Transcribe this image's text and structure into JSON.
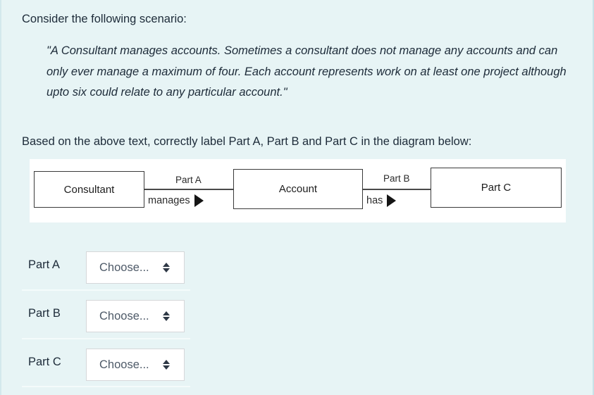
{
  "page": {
    "background_color": "#e7f4f5",
    "text_color": "#1d2b39"
  },
  "question": {
    "intro": "Consider the following scenario:",
    "scenario_quote": "\"A Consultant manages accounts.  Sometimes a consultant does not manage any accounts and can only ever manage a maximum of four.  Each account represents work on at least one project although upto six could relate to any particular account.\"",
    "instruction": "Based on the above text, correctly label Part A, Part B and Part C in the diagram below:"
  },
  "diagram": {
    "entities": [
      {
        "id": "consultant",
        "label": "Consultant"
      },
      {
        "id": "account",
        "label": "Account"
      },
      {
        "id": "partc",
        "label": "Part C"
      }
    ],
    "relationships": [
      {
        "id": "rel-a",
        "cardinality_label": "Part A",
        "verb_label": "manages",
        "arrow": "right-triangle-arrow",
        "from": "consultant",
        "to": "account"
      },
      {
        "id": "rel-b",
        "cardinality_label": "Part B",
        "verb_label": "has",
        "arrow": "right-triangle-arrow",
        "from": "account",
        "to": "partc"
      }
    ]
  },
  "answers": {
    "placeholder": "Choose...",
    "rows": [
      {
        "id": "part-a",
        "label": "Part A",
        "value": "Choose..."
      },
      {
        "id": "part-b",
        "label": "Part B",
        "value": "Choose..."
      },
      {
        "id": "part-c",
        "label": "Part C",
        "value": "Choose..."
      }
    ]
  },
  "icons": {
    "select_caret": "up-down-caret-icon",
    "relationship_arrow": "triangle-right-icon"
  }
}
